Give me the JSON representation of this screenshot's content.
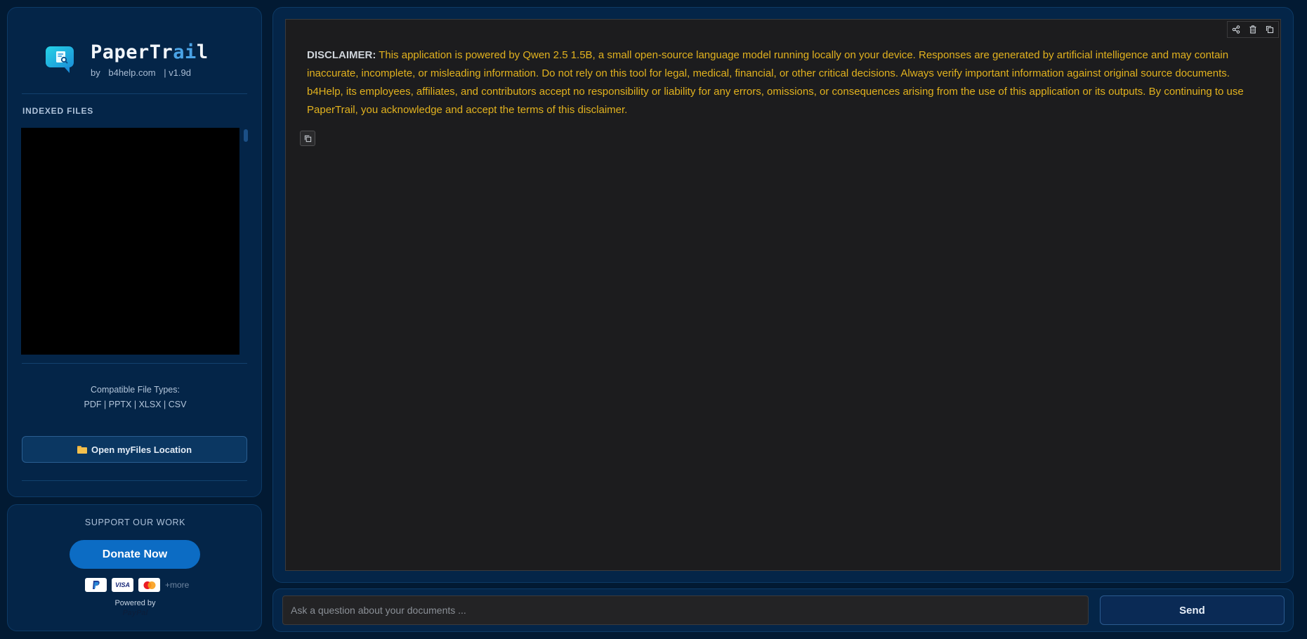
{
  "brand": {
    "title_part1": "PaperTr",
    "title_part2": "ai",
    "title_part3": "l",
    "by": "by",
    "site": "b4help.com",
    "version": "| v1.9d"
  },
  "sidebar": {
    "indexed_files_label": "INDEXED FILES",
    "compat_title": "Compatible File Types:",
    "compat_types": "PDF | PPTX | XLSX | CSV",
    "open_button_label": "Open myFiles Location"
  },
  "support": {
    "label": "SUPPORT OUR WORK",
    "donate_label": "Donate Now",
    "visa": "VISA",
    "more": "+more",
    "powered_by": "Powered by",
    "paypal": "PayPal"
  },
  "chat": {
    "disclaimer_label": "DISCLAIMER:",
    "disclaimer_text": " This application is powered by Qwen 2.5 1.5B, a small open-source language model running locally on your device. Responses are generated by artificial intelligence and may contain inaccurate, incomplete, or misleading information. Do not rely on this tool for legal, medical, financial, or other critical decisions. Always verify important information against original source documents. b4Help, its employees, affiliates, and contributors accept no responsibility or liability for any errors, omissions, or consequences arising from the use of this application or its outputs. By continuing to use PaperTrail, you acknowledge and accept the terms of this disclaimer."
  },
  "input": {
    "placeholder": "Ask a question about your documents ...",
    "value": "",
    "send_label": "Send"
  },
  "colors": {
    "background": "#021a33",
    "panel": "#042548",
    "accent": "#0c6cc4",
    "disclaimer_text": "#e2b21e",
    "chat_bg": "#1c1c1e"
  },
  "icons": {
    "logo": "chat-document-search-icon",
    "open_button": "folder-icon",
    "tools": [
      "share-icon",
      "trash-icon",
      "copy-icon"
    ],
    "message": "copy-icon"
  }
}
